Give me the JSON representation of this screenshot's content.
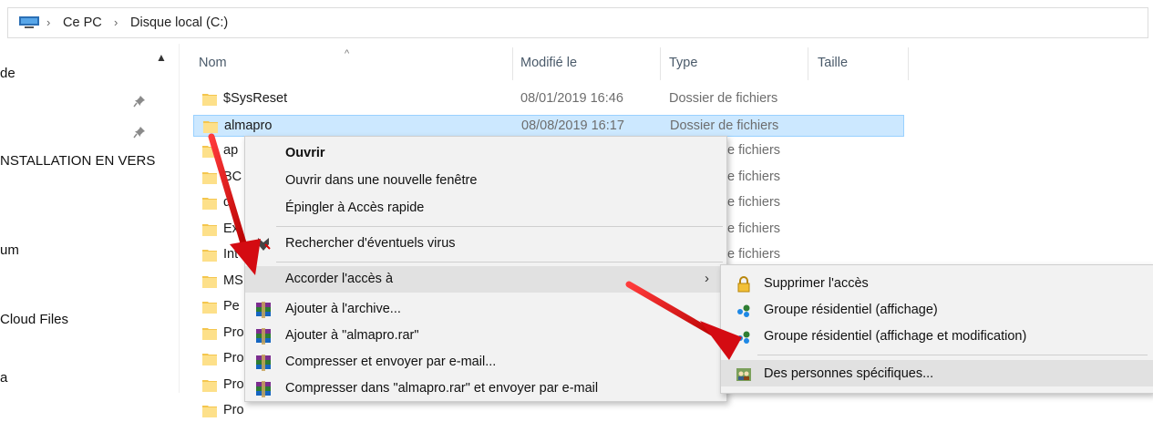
{
  "breadcrumb": {
    "icon": "this-pc-icon",
    "items": [
      "Ce PC",
      "Disque local (C:)"
    ]
  },
  "nav": {
    "items": [
      "de",
      "NSTALLATION EN VERS",
      "um",
      "Cloud Files",
      "a"
    ]
  },
  "columns": {
    "name": "Nom",
    "modified": "Modifié le",
    "type": "Type",
    "size": "Taille"
  },
  "files": [
    {
      "name": "$SysReset",
      "modified": "08/01/2019 16:46",
      "type": "Dossier de fichiers"
    },
    {
      "name": "almapro",
      "modified": "08/08/2019 16:17",
      "type": "Dossier de fichiers",
      "selected": true
    },
    {
      "name": "ap",
      "modified": "",
      "type": "e fichiers"
    },
    {
      "name": "BC",
      "modified": "",
      "type": "e fichiers"
    },
    {
      "name": "d",
      "modified": "",
      "type": "e fichiers"
    },
    {
      "name": "Ex",
      "modified": "",
      "type": "e fichiers"
    },
    {
      "name": "Int",
      "modified": "",
      "type": "e fichiers"
    },
    {
      "name": "MS",
      "modified": "",
      "type": ""
    },
    {
      "name": "Pe",
      "modified": "",
      "type": ""
    },
    {
      "name": "Pro",
      "modified": "",
      "type": ""
    },
    {
      "name": "Pro",
      "modified": "",
      "type": ""
    },
    {
      "name": "Pro",
      "modified": "",
      "type": ""
    },
    {
      "name": "Pro",
      "modified": "",
      "type": ""
    }
  ],
  "context_menu": {
    "open": "Ouvrir",
    "open_new_window": "Ouvrir dans une nouvelle fenêtre",
    "pin_quick_access": "Épingler à Accès rapide",
    "scan_virus": "Rechercher d'éventuels virus",
    "give_access": "Accorder l'accès à",
    "add_archive": "Ajouter à l'archive...",
    "add_rar": "Ajouter à \"almapro.rar\"",
    "compress_email": "Compresser et envoyer par e-mail...",
    "compress_rar_email": "Compresser dans \"almapro.rar\" et envoyer par e-mail"
  },
  "submenu": {
    "remove_access": "Supprimer l'accès",
    "homegroup_view": "Groupe résidentiel (affichage)",
    "homegroup_edit": "Groupe résidentiel (affichage et modification)",
    "specific_people": "Des personnes spécifiques..."
  },
  "colors": {
    "selection_bg": "#cce8ff",
    "selection_border": "#99d1ff",
    "menu_bg": "#f2f2f2",
    "menu_highlight": "#e1e1e1",
    "arrow_red": "#e0121a"
  }
}
